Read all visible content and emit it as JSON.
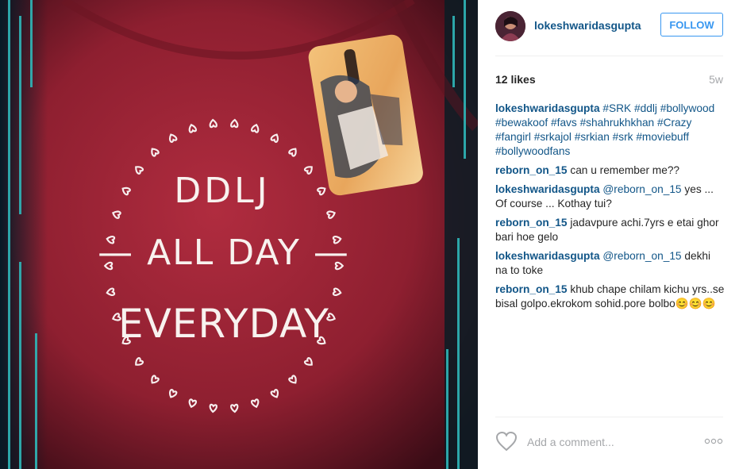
{
  "post": {
    "username": "lokeshwaridasgupta",
    "follow_label": "FOLLOW",
    "likes": "12 likes",
    "age": "5w",
    "caption": {
      "user": "lokeshwaridasgupta",
      "hashtags": [
        "#SRK",
        "#ddlj",
        "#bollywood",
        "#bewakoof",
        "#favs",
        "#shahrukhkhan",
        "#Crazy",
        "#fangirl",
        "#srkajol",
        "#srkian",
        "#srk",
        "#moviebuff",
        "#bollywoodfans"
      ]
    },
    "comments": [
      {
        "user": "reborn_on_15",
        "mention": "",
        "text": "can u remember me??"
      },
      {
        "user": "lokeshwaridasgupta",
        "mention": "@reborn_on_15",
        "text": "yes ... Of course ... Kothay tui?"
      },
      {
        "user": "reborn_on_15",
        "mention": "",
        "text": "jadavpure achi.7yrs e etai ghor bari hoe gelo"
      },
      {
        "user": "lokeshwaridasgupta",
        "mention": "@reborn_on_15",
        "text": "dekhi na to toke"
      },
      {
        "user": "reborn_on_15",
        "mention": "",
        "text": "khub chape chilam kichu yrs..se bisal golpo.ekrokom sohid.pore bolbo😊😊😊"
      }
    ],
    "add_comment_placeholder": "Add a comment...",
    "photo_text": {
      "line1": "DDLJ",
      "line2": "— ALL DAY —",
      "line3": "EVERYDAY"
    },
    "colors": {
      "link": "#125688",
      "follow": "#3897f0",
      "shirt": "#9b2335",
      "muted": "#a5a7aa"
    },
    "icons": {
      "like": "heart-outline-icon",
      "options": "more-options-icon"
    }
  }
}
